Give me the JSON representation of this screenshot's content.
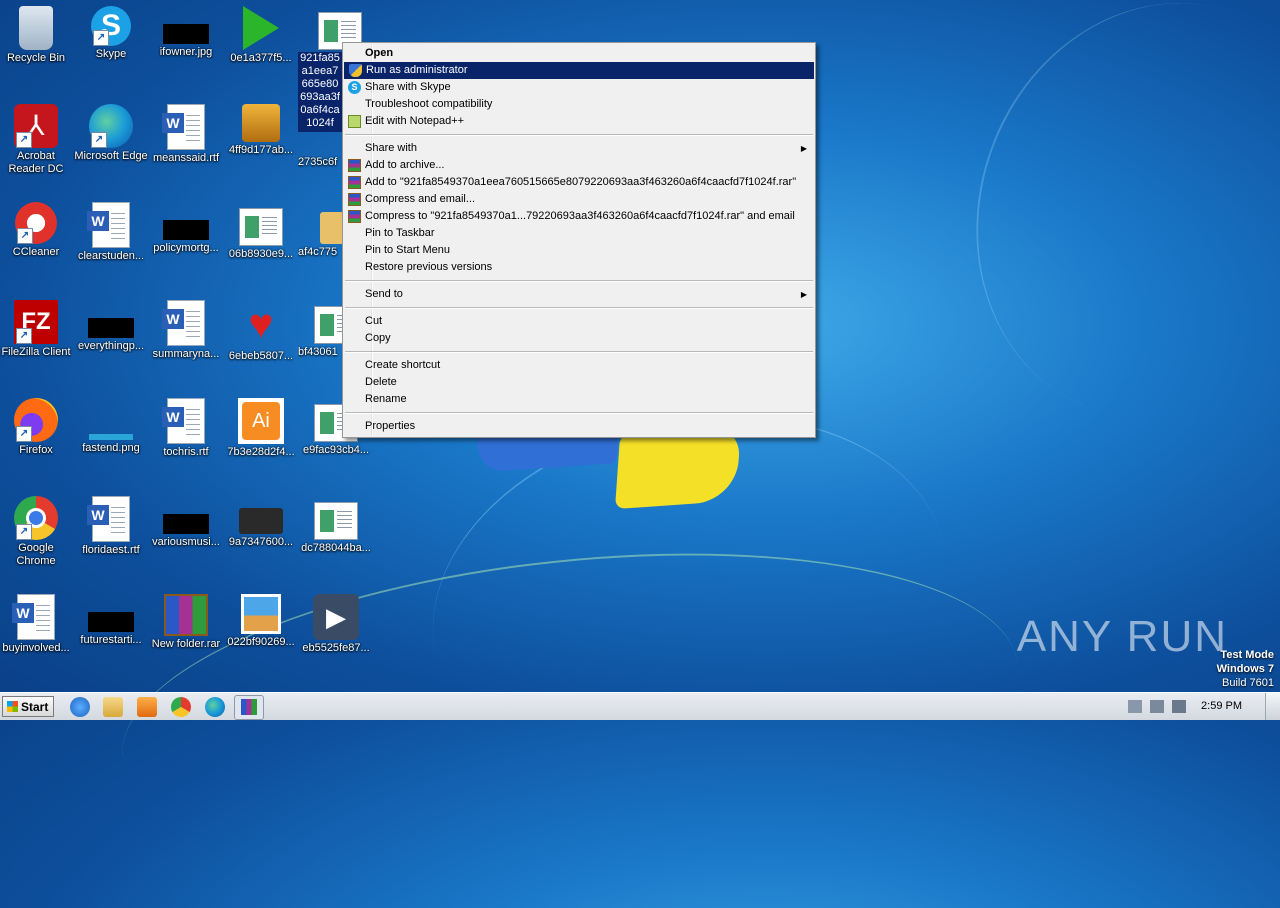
{
  "desktop": {
    "icons": [
      {
        "label": "Recycle Bin",
        "icon": "recycle-bin-icon"
      },
      {
        "label": "Skype",
        "icon": "skype-icon"
      },
      {
        "label": "ifowner.jpg",
        "icon": "redacted-thumbnail-icon"
      },
      {
        "label": "0e1a377f5...",
        "icon": "green-play-icon"
      },
      {
        "label": "921fa85 a1eea7 665e80 693aa3f 0a6f4ca 1024f",
        "icon": "executable-file-icon"
      },
      {
        "label": "Acrobat Reader DC",
        "icon": "acrobat-reader-icon"
      },
      {
        "label": "Microsoft Edge",
        "icon": "edge-icon"
      },
      {
        "label": "meanssaid.rtf",
        "icon": "word-document-icon"
      },
      {
        "label": "4ff9d177ab...",
        "icon": "setup-installer-icon"
      },
      {
        "label": "2735c6f",
        "icon": "installer-icon"
      },
      {
        "label": "CCleaner",
        "icon": "ccleaner-icon"
      },
      {
        "label": "clearstuden...",
        "icon": "word-document-icon"
      },
      {
        "label": "policymortg...",
        "icon": "redacted-thumbnail-icon"
      },
      {
        "label": "06b8930e9...",
        "icon": "window-file-icon"
      },
      {
        "label": "af4c775",
        "icon": "folder-icon"
      },
      {
        "label": "FileZilla Client",
        "icon": "filezilla-icon"
      },
      {
        "label": "everythingp...",
        "icon": "redacted-thumbnail-icon"
      },
      {
        "label": "summaryna...",
        "icon": "word-document-icon"
      },
      {
        "label": "6ebeb5807...",
        "icon": "heart-shield-icon"
      },
      {
        "label": "bf43061",
        "icon": "window-file-icon"
      },
      {
        "label": "Firefox",
        "icon": "firefox-icon"
      },
      {
        "label": "fastend.png",
        "icon": "png-image-icon"
      },
      {
        "label": "tochris.rtf",
        "icon": "word-document-icon"
      },
      {
        "label": "7b3e28d2f4...",
        "icon": "illustrator-icon"
      },
      {
        "label": "e9fac93cb4...",
        "icon": "window-file-icon"
      },
      {
        "label": "Google Chrome",
        "icon": "chrome-icon"
      },
      {
        "label": "floridaest.rtf",
        "icon": "word-document-icon"
      },
      {
        "label": "variousmusi...",
        "icon": "redacted-thumbnail-icon"
      },
      {
        "label": "9a7347600...",
        "icon": "chip-icon"
      },
      {
        "label": "dc788044ba...",
        "icon": "window-file-icon"
      },
      {
        "label": "buyinvolved...",
        "icon": "word-document-icon"
      },
      {
        "label": "futurestarti...",
        "icon": "redacted-thumbnail-icon"
      },
      {
        "label": "New folder.rar",
        "icon": "winrar-archive-icon"
      },
      {
        "label": "022bf90269...",
        "icon": "photo-icon"
      },
      {
        "label": "eb5525fe87...",
        "icon": "media-player-icon"
      }
    ]
  },
  "context_menu": {
    "items": [
      {
        "label": "Open",
        "bold": true
      },
      {
        "label": "Run as administrator",
        "icon": "uac-shield-icon",
        "highlighted": true
      },
      {
        "label": "Share with Skype",
        "icon": "skype-icon"
      },
      {
        "label": "Troubleshoot compatibility"
      },
      {
        "label": "Edit with Notepad++",
        "icon": "notepad-plus-plus-icon"
      },
      {
        "label": "Share with",
        "submenu": true
      },
      {
        "label": "Add to archive...",
        "icon": "winrar-icon"
      },
      {
        "label": "Add to \"921fa8549370a1eea760515665e8079220693aa3f463260a6f4caacfd7f1024f.rar\"",
        "icon": "winrar-icon"
      },
      {
        "label": "Compress and email...",
        "icon": "winrar-icon"
      },
      {
        "label": "Compress to \"921fa8549370a1...79220693aa3f463260a6f4caacfd7f1024f.rar\" and email",
        "icon": "winrar-icon"
      },
      {
        "label": "Pin to Taskbar"
      },
      {
        "label": "Pin to Start Menu"
      },
      {
        "label": "Restore previous versions"
      },
      {
        "label": "Send to",
        "submenu": true
      },
      {
        "label": "Cut"
      },
      {
        "label": "Copy"
      },
      {
        "label": "Create shortcut"
      },
      {
        "label": "Delete"
      },
      {
        "label": "Rename"
      },
      {
        "label": "Properties"
      }
    ]
  },
  "taskbar": {
    "start_label": "Start",
    "pinned": [
      "internet-explorer-icon",
      "file-explorer-icon",
      "media-player-icon",
      "chrome-icon",
      "edge-icon",
      "winrar-icon"
    ],
    "clock": "2:59 PM"
  },
  "watermark": {
    "brand": "ANY RUN",
    "line1": "Test Mode",
    "line2": "Windows 7",
    "line3": "Build 7601"
  }
}
